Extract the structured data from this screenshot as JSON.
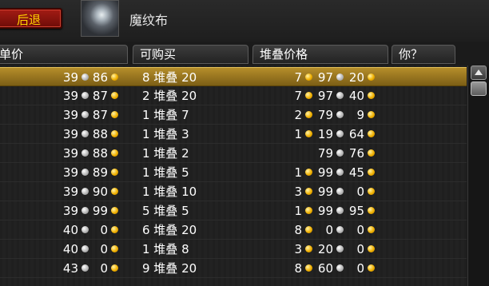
{
  "toolbar": {
    "back_label": "后退",
    "item_name": "魔纹布",
    "item_icon": "cloth-icon"
  },
  "columns": [
    {
      "label": "单价"
    },
    {
      "label": "可购买"
    },
    {
      "label": "堆叠价格"
    },
    {
      "label": "你？"
    }
  ],
  "rows": [
    {
      "unit": {
        "g": "39",
        "s": "86"
      },
      "buyable": "8 堆叠 20",
      "stack": {
        "g": "7",
        "s": "97",
        "c": "20"
      },
      "selected": true
    },
    {
      "unit": {
        "g": "39",
        "s": "87"
      },
      "buyable": "2 堆叠 20",
      "stack": {
        "g": "7",
        "s": "97",
        "c": "40"
      }
    },
    {
      "unit": {
        "g": "39",
        "s": "87"
      },
      "buyable": "1 堆叠 7",
      "stack": {
        "g": "2",
        "s": "79",
        "c": "9"
      }
    },
    {
      "unit": {
        "g": "39",
        "s": "88"
      },
      "buyable": "1 堆叠 3",
      "stack": {
        "g": "1",
        "s": "19",
        "c": "64"
      }
    },
    {
      "unit": {
        "g": "39",
        "s": "88"
      },
      "buyable": "1 堆叠 2",
      "stack": {
        "g": "",
        "s": "79",
        "c": "76"
      }
    },
    {
      "unit": {
        "g": "39",
        "s": "89"
      },
      "buyable": "1 堆叠 5",
      "stack": {
        "g": "1",
        "s": "99",
        "c": "45"
      }
    },
    {
      "unit": {
        "g": "39",
        "s": "90"
      },
      "buyable": "1 堆叠 10",
      "stack": {
        "g": "3",
        "s": "99",
        "c": "0"
      }
    },
    {
      "unit": {
        "g": "39",
        "s": "99"
      },
      "buyable": "5 堆叠 5",
      "stack": {
        "g": "1",
        "s": "99",
        "c": "95"
      }
    },
    {
      "unit": {
        "g": "40",
        "s": "0"
      },
      "buyable": "6 堆叠 20",
      "stack": {
        "g": "8",
        "s": "0",
        "c": "0"
      }
    },
    {
      "unit": {
        "g": "40",
        "s": "0"
      },
      "buyable": "1 堆叠 8",
      "stack": {
        "g": "3",
        "s": "20",
        "c": "0"
      }
    },
    {
      "unit": {
        "g": "43",
        "s": "0"
      },
      "buyable": "9 堆叠 20",
      "stack": {
        "g": "8",
        "s": "60",
        "c": "0"
      }
    }
  ]
}
